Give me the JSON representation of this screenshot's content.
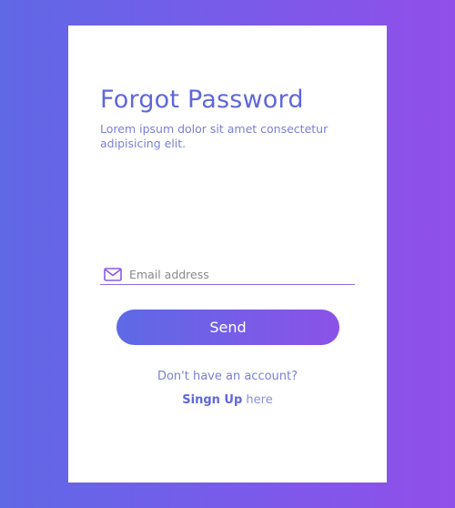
{
  "form": {
    "title": "Forgot Password",
    "subtitle": "Lorem ipsum dolor sit amet consectetur adipisicing elit.",
    "email_placeholder": "Email address",
    "email_value": "",
    "send_label": "Send",
    "no_account_text": "Don't have an account?",
    "signup_link_label": "Singn Up",
    "signup_suffix": " here"
  },
  "icons": {
    "email": "envelope-icon"
  },
  "colors": {
    "background_start": "#5f68e6",
    "background_end": "#914fe9",
    "accent": "#5f68d9",
    "card": "#ffffff"
  }
}
